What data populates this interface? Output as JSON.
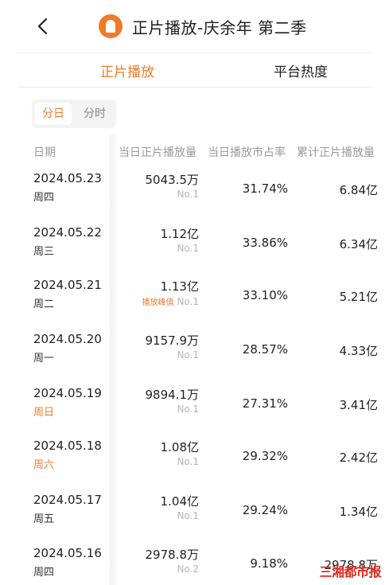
{
  "header": {
    "back_icon": "chevron-left-icon",
    "logo_icon": "app-logo-icon",
    "title": "正片播放-庆余年 第二季"
  },
  "tabs": [
    {
      "label": "正片播放",
      "active": true
    },
    {
      "label": "平台热度",
      "active": false
    }
  ],
  "segment": [
    {
      "label": "分日",
      "active": true
    },
    {
      "label": "分时",
      "active": false
    }
  ],
  "table": {
    "headers": [
      "日期",
      "当日正片播放量",
      "当日播放市占率",
      "累计正片播放量"
    ],
    "rows": [
      {
        "date": "2024.05.23",
        "weekday": "周四",
        "weekend": false,
        "daily": "5043.5万",
        "peak": "",
        "rank": "No.1",
        "share": "31.74%",
        "cumulative": "6.84亿"
      },
      {
        "date": "2024.05.22",
        "weekday": "周三",
        "weekend": false,
        "daily": "1.12亿",
        "peak": "",
        "rank": "No.1",
        "share": "33.86%",
        "cumulative": "6.34亿"
      },
      {
        "date": "2024.05.21",
        "weekday": "周二",
        "weekend": false,
        "daily": "1.13亿",
        "peak": "播放峰值",
        "rank": "No.1",
        "share": "33.10%",
        "cumulative": "5.21亿"
      },
      {
        "date": "2024.05.20",
        "weekday": "周一",
        "weekend": false,
        "daily": "9157.9万",
        "peak": "",
        "rank": "No.1",
        "share": "28.57%",
        "cumulative": "4.33亿"
      },
      {
        "date": "2024.05.19",
        "weekday": "周日",
        "weekend": true,
        "daily": "9894.1万",
        "peak": "",
        "rank": "No.1",
        "share": "27.31%",
        "cumulative": "3.41亿"
      },
      {
        "date": "2024.05.18",
        "weekday": "周六",
        "weekend": true,
        "daily": "1.08亿",
        "peak": "",
        "rank": "No.1",
        "share": "29.32%",
        "cumulative": "2.42亿"
      },
      {
        "date": "2024.05.17",
        "weekday": "周五",
        "weekend": false,
        "daily": "1.04亿",
        "peak": "",
        "rank": "No.1",
        "share": "29.24%",
        "cumulative": "1.34亿"
      },
      {
        "date": "2024.05.16",
        "weekday": "周四",
        "weekend": false,
        "daily": "2978.8万",
        "peak": "",
        "rank": "No.2",
        "share": "9.18%",
        "cumulative": "2978.8万"
      }
    ]
  },
  "watermark": "三湘都市报",
  "colors": {
    "accent": "#f07a2a",
    "watermark": "#e42a1f"
  }
}
